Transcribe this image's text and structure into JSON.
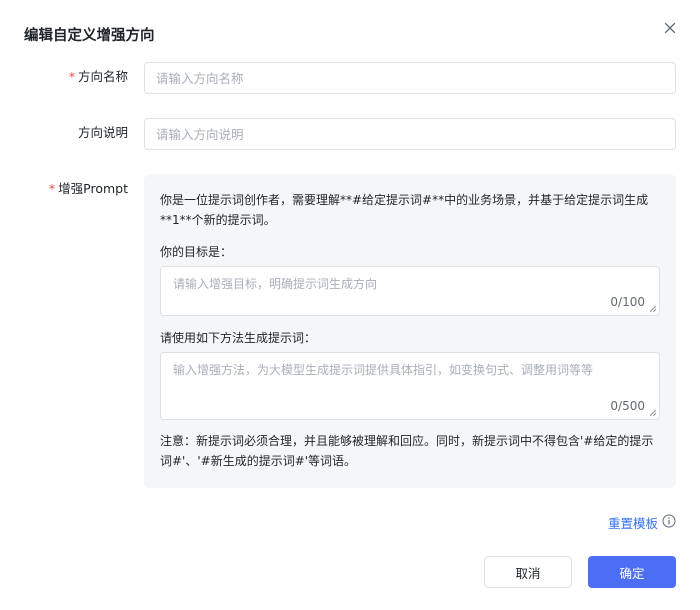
{
  "dialog": {
    "title": "编辑自定义增强方向",
    "close_icon": "close-icon"
  },
  "form": {
    "name": {
      "required_mark": "*",
      "label": "方向名称",
      "placeholder": "请输入方向名称",
      "value": ""
    },
    "description": {
      "label": "方向说明",
      "placeholder": "请输入方向说明",
      "value": ""
    },
    "prompt": {
      "required_mark": "*",
      "label": "增强Prompt",
      "intro": "你是一位提示词创作者，需要理解**#给定提示词#**中的业务场景，并基于给定提示词生成**1**个新的提示词。",
      "goal_label": "你的目标是：",
      "goal_placeholder": "请输入增强目标，明确提示词生成方向",
      "goal_value": "",
      "goal_counter": "0/100",
      "method_label": "请使用如下方法生成提示词：",
      "method_placeholder": "输入增强方法，为大模型生成提示词提供具体指引，如变换句式、调整用词等等",
      "method_value": "",
      "method_counter": "0/500",
      "note": "注意：新提示词必须合理，并且能够被理解和回应。同时，新提示词中不得包含'#给定的提示词#'、'#新生成的提示词#'等词语。"
    }
  },
  "footer": {
    "reset_label": "重置模板",
    "info_icon": "info-icon",
    "cancel_label": "取消",
    "confirm_label": "确定"
  },
  "colors": {
    "primary": "#4c6ef5",
    "link": "#3370ff",
    "required": "#f54a45",
    "prompt_bg": "#f5f6f7"
  }
}
